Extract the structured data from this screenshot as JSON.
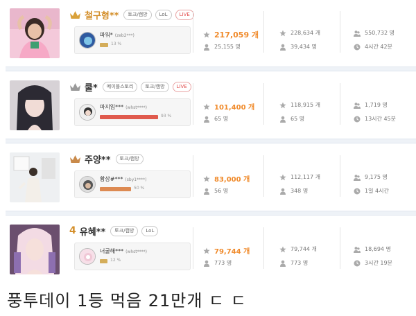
{
  "rows": [
    {
      "rank_text": "",
      "show_crown": "gold",
      "name": "철구형**",
      "name_color": "#d48f2b",
      "tags": [
        "토크/캠방",
        "LoL"
      ],
      "live": "LIVE",
      "fan_name": "파워*",
      "fan_id": "(zeb2***)",
      "fan_pct_label": "13 %",
      "fan_pct": 0.13,
      "bar_color": "#d4ad5a",
      "balloons": "217,059 개",
      "viewers": "25,155 명",
      "total_balloons": "228,634 개",
      "total_viewers": "39,434 명",
      "fans": "550,732 명",
      "airtime": "4시간 42분"
    },
    {
      "rank_text": "",
      "show_crown": "silver",
      "name": "쿨*",
      "name_color": "#333333",
      "tags": [
        "메이플스토리",
        "토크/캠방"
      ],
      "live": "LIVE",
      "fan_name": "마지임***",
      "fan_id": "(whst****)",
      "fan_pct_label": "93 %",
      "fan_pct": 0.93,
      "bar_color": "#e05a4d",
      "balloons": "101,400 개",
      "viewers": "65 명",
      "total_balloons": "118,915 개",
      "total_viewers": "65 명",
      "fans": "1,719 명",
      "airtime": "13시간 45분"
    },
    {
      "rank_text": "",
      "show_crown": "bronze",
      "name": "주양**",
      "name_color": "#333333",
      "tags": [
        "토크/캠방"
      ],
      "live": "",
      "fan_name": "황상#***",
      "fan_id": "(sby1****)",
      "fan_pct_label": "50 %",
      "fan_pct": 0.5,
      "bar_color": "#dd8a52",
      "balloons": "83,000 개",
      "viewers": "56 명",
      "total_balloons": "112,117 개",
      "total_viewers": "348 명",
      "fans": "9,175 명",
      "airtime": "1일 4시간"
    },
    {
      "rank_text": "4",
      "show_crown": "",
      "name": "유혜**",
      "name_color": "#333333",
      "tags": [
        "토크/캠방",
        "LoL"
      ],
      "live": "",
      "fan_name": "너굴해***",
      "fan_id": "(whst****)",
      "fan_pct_label": "12 %",
      "fan_pct": 0.12,
      "bar_color": "#d4ad5a",
      "balloons": "79,744 개",
      "viewers": "773 명",
      "total_balloons": "79,744 개",
      "total_viewers": "773 명",
      "fans": "18,694 명",
      "airtime": "3시간 19분"
    }
  ],
  "caption": "풍투데이 1등 먹음 21만개 ㄷ ㄷ",
  "icons": {
    "crown": "crown-icon",
    "star": "star-icon",
    "person": "person-icon",
    "fans": "fans-icon",
    "clock": "clock-icon"
  },
  "colors": {
    "accent": "#f08a2a",
    "gold": "#d9a13a",
    "silver": "#9a9a9a",
    "bronze": "#c98a4a"
  }
}
